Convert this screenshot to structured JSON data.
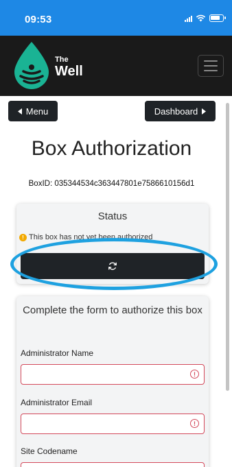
{
  "status_bar": {
    "time": "09:53"
  },
  "navbar": {
    "brand_line1": "The",
    "brand_line2": "Well",
    "logo_icon": "water-drop-logo-icon",
    "menu_toggle_icon": "hamburger-icon"
  },
  "nav": {
    "menu_label": "Menu",
    "dashboard_label": "Dashboard"
  },
  "page": {
    "title": "Box Authorization",
    "box_id": "BoxID: 035344534c363447801e7586610156d1"
  },
  "status_card": {
    "title": "Status",
    "message": "This box has not yet been authorized",
    "refresh_icon": "refresh-icon"
  },
  "form": {
    "heading": "Complete the form to authorize this box",
    "fields": [
      {
        "label": "Administrator Name",
        "value": ""
      },
      {
        "label": "Administrator Email",
        "value": ""
      },
      {
        "label": "Site Codename",
        "value": ""
      }
    ]
  },
  "colors": {
    "status_bar": "#1e88e5",
    "navbar": "#1a1a1a",
    "button": "#1f2327",
    "highlight": "#1ea1e0",
    "invalid": "#d3485a",
    "warning": "#f2a900",
    "logo": "#1ab394"
  }
}
